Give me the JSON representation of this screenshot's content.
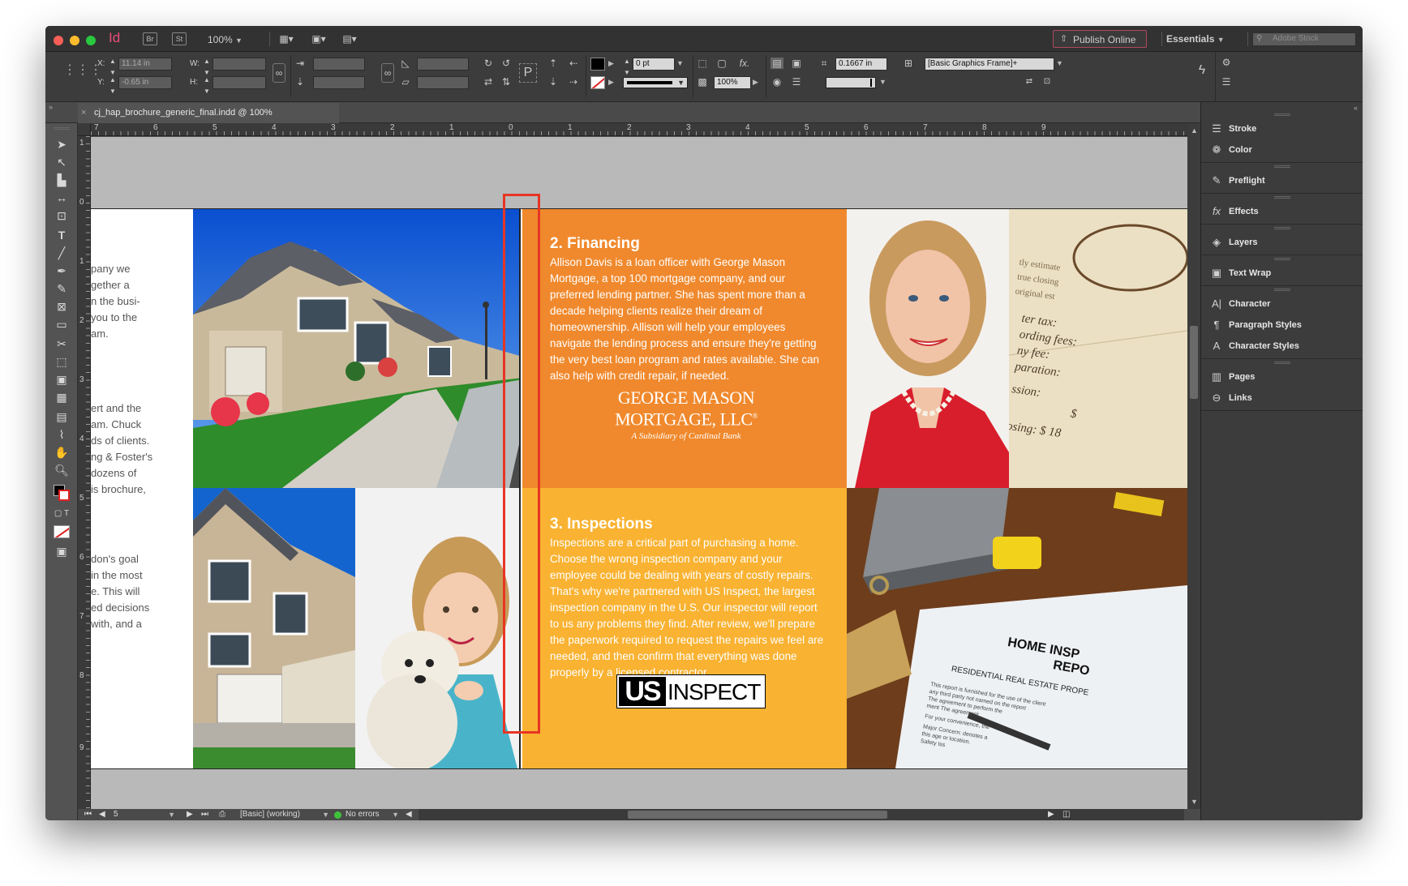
{
  "window": {
    "app_icon": "Id",
    "bridge": "Br",
    "stock": "St",
    "zoom": "100%",
    "publish_label": "Publish Online",
    "workspace": "Essentials",
    "search_placeholder": "Adobe Stock"
  },
  "colors": {
    "accent": "#ea4d7b",
    "orange": "#f0892d",
    "yellow": "#f9b231",
    "highlight_box": "#e73524"
  },
  "control": {
    "x_label": "X:",
    "y_label": "Y:",
    "w_label": "W:",
    "h_label": "H:",
    "x_value": "11.14 in",
    "y_value": "-0.65 in",
    "stroke_weight": "0 pt",
    "opacity": "100%",
    "fitting_value": "0.1667 in",
    "object_style": "[Basic Graphics Frame]+",
    "ref_icon_name": "reference-point-icon"
  },
  "document": {
    "tab_title": "cj_hap_brochure_generic_final.indd @ 100%"
  },
  "ruler": {
    "h_ticks": [
      "7",
      "6",
      "5",
      "4",
      "3",
      "2",
      "1",
      "0",
      "1",
      "2",
      "3",
      "4",
      "5",
      "6",
      "7",
      "8",
      "9"
    ],
    "v_ticks": [
      "1",
      "0",
      "1",
      "2",
      "3",
      "4",
      "5",
      "6",
      "7",
      "8",
      "9"
    ]
  },
  "page": {
    "left_col_top": [
      "pany we",
      "gether a",
      "n the busi-",
      "you to the",
      "am."
    ],
    "left_col_mid": [
      "ert and the",
      "am. Chuck",
      "ds of clients.",
      "ng & Foster's",
      "dozens of",
      "is brochure,"
    ],
    "left_col_bottom": [
      "don's goal",
      "in the most",
      "e. This will",
      "ed decisions",
      "with, and a"
    ],
    "financing": {
      "title": "2. Financing",
      "body": "Allison Davis is a loan officer with George Mason Mortgage, a top 100 mortgage company, and our preferred lending partner. She has spent more than a decade helping clients realize their dream of homeownership. Allison will help your employees navigate the lending process and ensure they're getting the very best loan program and rates available. She can also help with credit repair, if needed.",
      "logo_line1": "GEORGE MASON",
      "logo_line2": "MORTGAGE, LLC",
      "logo_mark": "®",
      "logo_tagline": "A Subsidiary of Cardinal Bank"
    },
    "inspections": {
      "title": "3. Inspections",
      "body": "Inspections are a critical part of purchasing a home. Choose the wrong inspection company and your employee could be dealing with years of costly repairs. That's why we're partnered with US Inspect, the largest inspection company in the U.S. Our inspector will report to us any problems they find. After review, we'll prepare the paperwork required to request the repairs we feel are needed, and then confirm that everything was done properly by a licensed contractor.",
      "logo_us": "US",
      "logo_inspect": "INSPECT"
    },
    "doc_photo_text": [
      "tly estimate",
      "true closing",
      "original est",
      "ter tax:",
      "ording fees:",
      "ny fee:",
      "paration:",
      "ssion:",
      "$",
      "osing:",
      "$ 18"
    ],
    "inspection_photo_text": {
      "title": "HOME INSP",
      "title2": "REPO",
      "subtitle": "RESIDENTIAL REAL ESTATE PROPE",
      "lines": [
        "This report is furnished for the use of the client",
        "any third party not named on the report",
        "The agreement to perform the",
        "ment The agreement",
        "For your convenience, the",
        "Major Concern: denotes a",
        "this age or location.",
        "Safety Iss"
      ]
    }
  },
  "status": {
    "page_num": "5",
    "preflight_profile": "[Basic] (working)",
    "errors": "No errors"
  },
  "panels": {
    "stroke": "Stroke",
    "color": "Color",
    "preflight": "Preflight",
    "effects": "Effects",
    "layers": "Layers",
    "text_wrap": "Text Wrap",
    "character": "Character",
    "paragraph_styles": "Paragraph Styles",
    "character_styles": "Character Styles",
    "pages": "Pages",
    "links": "Links"
  }
}
